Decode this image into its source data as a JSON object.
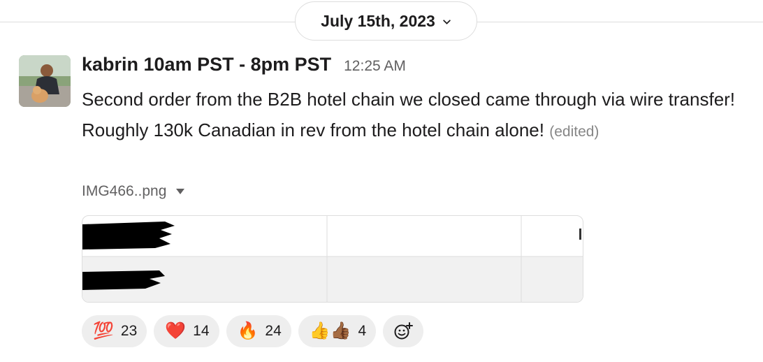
{
  "date_divider": {
    "label": "July 15th, 2023",
    "icon": "chevron-down-icon"
  },
  "message": {
    "author": "kabrin 10am PST - 8pm PST",
    "timestamp": "12:25 AM",
    "text": "Second order from the B2B hotel chain we closed came through via wire transfer! Roughly 130k Canadian in rev from the hotel chain alone!",
    "edited_label": "(edited)"
  },
  "attachment": {
    "filename": "IMG466..png",
    "toggle_icon": "caret-down-icon"
  },
  "reactions": [
    {
      "emoji": "💯",
      "count": "23"
    },
    {
      "emoji": "❤️",
      "count": "14"
    },
    {
      "emoji": "🔥",
      "count": "24"
    },
    {
      "emoji": "👍👍🏾",
      "count": "4"
    }
  ],
  "add_reaction": {
    "icon": "add-reaction-icon"
  }
}
